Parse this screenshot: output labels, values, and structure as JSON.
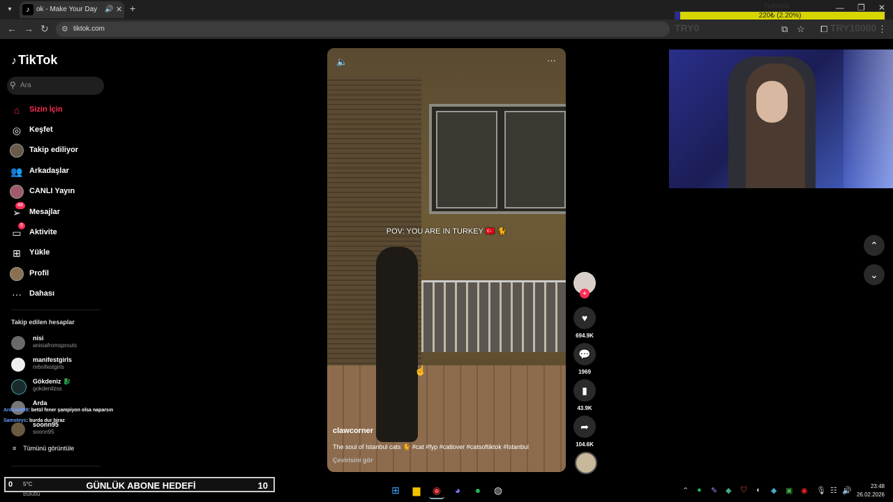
{
  "browser": {
    "tab_title": "ok - Make Your Day",
    "url": "tiktok.com"
  },
  "overlay": {
    "top_label": "TUPMAK",
    "bar_text": "220₺ (2.20%)",
    "bar_fraction": 0.022,
    "try_left": "TRY0",
    "try_right": "TRY10000"
  },
  "tiktok": {
    "logo": "TikTok",
    "search_placeholder": "Ara",
    "nav": [
      {
        "label": "Sizin İçin",
        "icon": "home-icon",
        "active": true
      },
      {
        "label": "Keşfet",
        "icon": "compass-icon"
      },
      {
        "label": "Takip ediliyor",
        "icon": "avatar"
      },
      {
        "label": "Arkadaşlar",
        "icon": "friends-icon"
      },
      {
        "label": "CANLI Yayın",
        "icon": "live-icon"
      },
      {
        "label": "Mesajlar",
        "icon": "message-icon",
        "badge": "48"
      },
      {
        "label": "Aktivite",
        "icon": "activity-icon",
        "badge": "5"
      },
      {
        "label": "Yükle",
        "icon": "upload-icon"
      },
      {
        "label": "Profil",
        "icon": "avatar"
      },
      {
        "label": "Dahası",
        "icon": "more-icon"
      }
    ],
    "following_header": "Takip edilen hesaplar",
    "following": [
      {
        "name": "nisi",
        "handle": "anisiafromsprouts"
      },
      {
        "name": "manifestgirls",
        "handle": "m6nifestgirls"
      },
      {
        "name": "Gökdeniz 🐉",
        "handle": "gokdenilzss"
      },
      {
        "name": "Arda",
        "handle": ""
      },
      {
        "name": "soonn95",
        "handle": "soonn95"
      }
    ],
    "see_all": "Tümünü görüntüle"
  },
  "chat": [
    {
      "user": "Ardaaa999",
      "text": ": betül fener şampiyon olsa naparsın"
    },
    {
      "user": "Samsteys",
      "text": ": burda dur biraz"
    }
  ],
  "video": {
    "overlay_text": "POV: YOU ARE IN TURKEY 🇹🇷 🐈",
    "author": "clawcorner",
    "description": "The soul of Istanbul cats 🐈 #cat #fyp #catlover #catsoftiktok #Istanbul",
    "translate": "Çevirisini gör",
    "likes": "694.9K",
    "comments": "1969",
    "saves": "43.9K",
    "shares": "104.6K"
  },
  "goal": {
    "label": "GÜNLÜK ABONE HEDEFİ",
    "value": "10",
    "left_value": "0"
  },
  "weather": {
    "temp": "5°C",
    "city": "Bulutlu"
  },
  "clock": {
    "time": "23:48",
    "date": "26.02.2026"
  }
}
